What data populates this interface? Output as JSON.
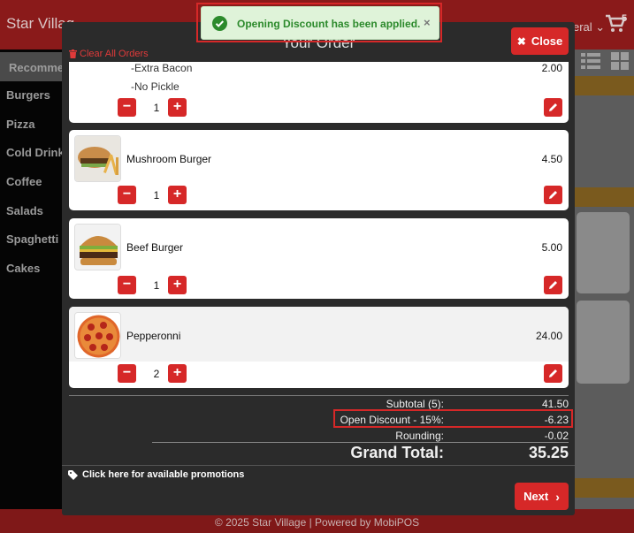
{
  "app": {
    "title": "Star Villag",
    "category_right": "eral",
    "cart_count": "5"
  },
  "sidebar": {
    "items": [
      {
        "label": "Recommer",
        "active": true
      },
      {
        "label": "Burgers"
      },
      {
        "label": "Pizza"
      },
      {
        "label": "Cold Drinks"
      },
      {
        "label": "Coffee"
      },
      {
        "label": "Salads"
      },
      {
        "label": "Spaghetti"
      },
      {
        "label": "Cakes"
      }
    ]
  },
  "footer": {
    "text": "© 2025 Star Village | Powered by MobiPOS"
  },
  "toast": {
    "message": "Opening Discount has been applied.",
    "close": "×"
  },
  "modal": {
    "title": "Your Order",
    "clear_all": "Clear All Orders",
    "close_label": "Close",
    "items": [
      {
        "name": "",
        "modifiers": [
          "-Extra Bacon",
          "-No Pickle"
        ],
        "modifier_price": "2.00",
        "qty": "1"
      },
      {
        "name": "Mushroom Burger",
        "price": "4.50",
        "qty": "1",
        "image": "burger-fries"
      },
      {
        "name": "Beef Burger",
        "price": "5.00",
        "qty": "1",
        "image": "beef-burger"
      },
      {
        "name": "Pepperonni",
        "price": "24.00",
        "qty": "2",
        "image": "pepperoni-pizza"
      }
    ],
    "totals": {
      "subtotal_label": "Subtotal (5):",
      "subtotal_value": "41.50",
      "discount_label": "Open Discount - 15%:",
      "discount_value": "-6.23",
      "rounding_label": "Rounding:",
      "rounding_value": "-0.02",
      "grand_label": "Grand Total:",
      "grand_value": "35.25"
    },
    "promo": "Click here for available promotions",
    "next_label": "Next"
  },
  "colors": {
    "accent": "#d62828",
    "success": "#2c8a2c",
    "modal_bg": "#2b2b2b"
  }
}
